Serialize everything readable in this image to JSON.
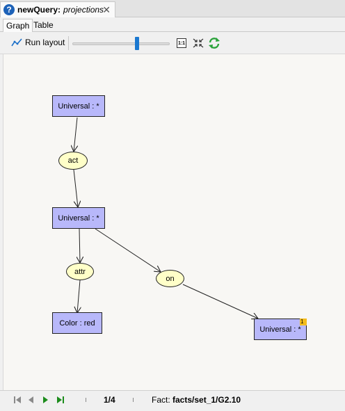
{
  "editor": {
    "tab_name": "newQuery:",
    "tab_subtitle": "projections",
    "close_glyph": "✕",
    "help_glyph": "?"
  },
  "subtabs": [
    {
      "label": "Graph",
      "active": true
    },
    {
      "label": "Table",
      "active": false
    }
  ],
  "toolbar": {
    "run_layout_label": "Run layout",
    "zoom_reset_label": "1:1",
    "icons": [
      "run-layout-icon",
      "zoom-slider",
      "zoom-1to1-icon",
      "fit-to-view-icon",
      "refresh-icon"
    ]
  },
  "graph": {
    "nodes": [
      {
        "id": "n1",
        "label": "Universal : *",
        "type": "concept"
      },
      {
        "id": "r1",
        "label": "act",
        "type": "relation"
      },
      {
        "id": "n2",
        "label": "Universal : *",
        "type": "concept"
      },
      {
        "id": "r2",
        "label": "attr",
        "type": "relation"
      },
      {
        "id": "r3",
        "label": "on",
        "type": "relation"
      },
      {
        "id": "n3",
        "label": "Color : red",
        "type": "concept"
      },
      {
        "id": "n4",
        "label": "Universal : *",
        "type": "concept",
        "badge": "1"
      }
    ],
    "edges": [
      {
        "from": "n1",
        "to": "r1"
      },
      {
        "from": "r1",
        "to": "n2"
      },
      {
        "from": "n2",
        "to": "r2"
      },
      {
        "from": "n2",
        "to": "r3"
      },
      {
        "from": "r2",
        "to": "n3"
      },
      {
        "from": "r3",
        "to": "n4"
      }
    ],
    "colors": {
      "concept_fill": "#b8b8fa",
      "relation_fill": "#ffffc8",
      "badge": "#f4bc1c"
    }
  },
  "status": {
    "page_indicator": "1/4",
    "fact_label": "Fact:",
    "fact_value": "facts/set_1/G2.10",
    "nav_icons": [
      "first-page-icon",
      "previous-page-icon",
      "next-page-icon",
      "last-page-icon"
    ]
  }
}
